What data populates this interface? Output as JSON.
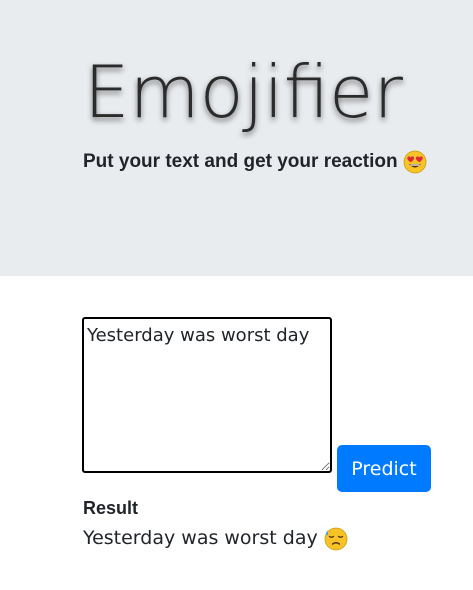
{
  "header": {
    "title": "Emojifier",
    "subtitle": "Put your text and get your reaction",
    "subtitle_emoji": "heart-eyes-emoji"
  },
  "form": {
    "input_value": "Yesterday was worst day",
    "predict_label": "Predict"
  },
  "result": {
    "label": "Result",
    "text": "Yesterday was worst day",
    "emoji": "downcast-sweat-emoji"
  },
  "colors": {
    "hero_background": "#e9ecef",
    "button_background": "#007bff",
    "button_text": "#ffffff"
  }
}
